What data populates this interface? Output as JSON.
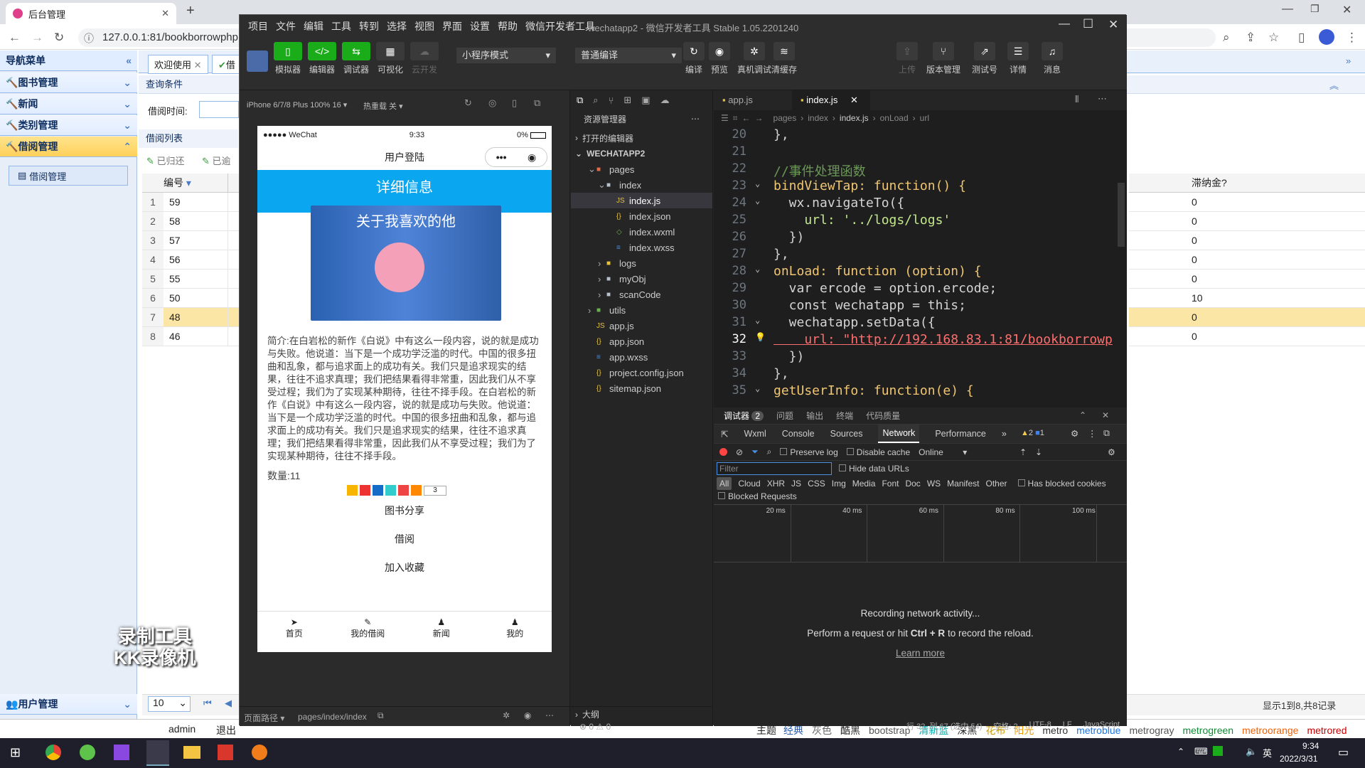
{
  "browser": {
    "tab_title": "后台管理",
    "url": "127.0.0.1:81/bookborrowphp"
  },
  "admin": {
    "nav_title": "导航菜单",
    "nav_sections": [
      {
        "label": "图书管理"
      },
      {
        "label": "新闻"
      },
      {
        "label": "类别管理"
      },
      {
        "label": "借阅管理"
      }
    ],
    "nav_sub_item": "借阅管理",
    "user_section": "用户管理",
    "tabs": [
      "欢迎使用",
      "借"
    ],
    "query_title": "查询条件",
    "borrow_time_label": "借阅时间:",
    "list_title": "借阅列表",
    "btn_returned": "已归还",
    "btn_overdue": "已逾",
    "col_id": "编号",
    "col_fine": "滞纳金?",
    "rows": [
      {
        "n": "1",
        "id": "59",
        "fine": "0"
      },
      {
        "n": "2",
        "id": "58",
        "fine": "0"
      },
      {
        "n": "3",
        "id": "57",
        "fine": "0"
      },
      {
        "n": "4",
        "id": "56",
        "fine": "0"
      },
      {
        "n": "5",
        "id": "55",
        "fine": "0"
      },
      {
        "n": "6",
        "id": "50",
        "fine": "10"
      },
      {
        "n": "7",
        "id": "48",
        "fine": "0"
      },
      {
        "n": "8",
        "id": "46",
        "fine": "0"
      }
    ],
    "page_size": "10",
    "page_info": "显示1到8,共8记录",
    "footer_user": "admin",
    "footer_logout": "退出",
    "theme_label": "主题",
    "themes": [
      "经典",
      "灰色",
      "酷黑",
      "bootstrap",
      "清新蓝",
      "深黑",
      "花布",
      "阳光",
      "metro",
      "metroblue",
      "metrogray",
      "metrogreen",
      "metroorange",
      "metrored"
    ],
    "watermark_line1": "录制工具",
    "watermark_line2": "KK录像机"
  },
  "devtool": {
    "menu": [
      "项目",
      "文件",
      "编辑",
      "工具",
      "转到",
      "选择",
      "视图",
      "界面",
      "设置",
      "帮助",
      "微信开发者工具"
    ],
    "title": "wechatapp2 - 微信开发者工具 Stable 1.05.2201240",
    "toolbar": {
      "simulator": "模拟器",
      "editor": "编辑器",
      "debugger": "调试器",
      "visual": "可视化",
      "cloud": "云开发",
      "mode": "小程序模式",
      "compile_mode": "普通编译",
      "compile": "编译",
      "preview": "预览",
      "real_debug": "真机调试",
      "clear_cache": "清缓存",
      "upload": "上传",
      "version": "版本管理",
      "test": "测试号",
      "details": "详情",
      "message": "消息"
    },
    "sim_device": "iPhone 6/7/8 Plus 100% 16 ▾",
    "sim_hot": "热重载 关 ▾",
    "phone": {
      "carrier": "●●●●● WeChat",
      "time": "9:33",
      "battery": "0%",
      "nav_title": "用户登陆",
      "header": "详细信息",
      "cover_text": "关于我喜欢的他",
      "intro": "简介:在白岩松的新作《白说》中有这么一段内容，说的就是成功与失败。他说道：当下是一个成功学泛滥的时代。中国的很多扭曲和乱象，都与追求面上的成功有关。我们只是追求现实的结果，往往不追求真理；我们把结果看得非常重，因此我们从不享受过程；我们为了实现某种期待，往往不择手段。在白岩松的新作《白说》中有这么一段内容，说的就是成功与失败。他说道：当下是一个成功学泛滥的时代。中国的很多扭曲和乱象，都与追求面上的成功有关。我们只是追求现实的结果，往往不追求真理；我们把结果看得非常重，因此我们从不享受过程；我们为了实现某种期待，往往不择手段。",
      "count": "数量:11",
      "share_count": "3",
      "share": "图书分享",
      "borrow": "借阅",
      "favorite": "加入收藏",
      "tabbar": [
        "首页",
        "我的借阅",
        "新闻",
        "我的"
      ]
    },
    "page_path_label": "页面路径 ▾",
    "page_path": "pages/index/index",
    "explorer": {
      "title": "资源管理器",
      "open_editors": "打开的编辑器",
      "project": "WECHATAPP2",
      "items": [
        {
          "name": "pages",
          "indent": 1,
          "kind": "folder-red"
        },
        {
          "name": "index",
          "indent": 2,
          "kind": "folder"
        },
        {
          "name": "index.js",
          "indent": 3,
          "kind": "js"
        },
        {
          "name": "index.json",
          "indent": 3,
          "kind": "json"
        },
        {
          "name": "index.wxml",
          "indent": 3,
          "kind": "wxml"
        },
        {
          "name": "index.wxss",
          "indent": 3,
          "kind": "wxss"
        },
        {
          "name": "logs",
          "indent": 2,
          "kind": "folder-yellow"
        },
        {
          "name": "myObj",
          "indent": 2,
          "kind": "folder"
        },
        {
          "name": "scanCode",
          "indent": 2,
          "kind": "folder"
        },
        {
          "name": "utils",
          "indent": 1,
          "kind": "folder-green"
        },
        {
          "name": "app.js",
          "indent": 1,
          "kind": "js"
        },
        {
          "name": "app.json",
          "indent": 1,
          "kind": "json"
        },
        {
          "name": "app.wxss",
          "indent": 1,
          "kind": "wxss"
        },
        {
          "name": "project.config.json",
          "indent": 1,
          "kind": "json"
        },
        {
          "name": "sitemap.json",
          "indent": 1,
          "kind": "json"
        }
      ],
      "outline": "大纲",
      "problems": "⊗ 0 ⚠ 0"
    },
    "editor": {
      "tab1": "app.js",
      "tab2": "index.js",
      "breadcrumb": [
        "pages",
        "index",
        "index.js",
        "onLoad",
        "url"
      ],
      "lines": [
        {
          "n": "20",
          "code": "},"
        },
        {
          "n": "21",
          "code": ""
        },
        {
          "n": "22",
          "code": "//事件处理函数"
        },
        {
          "n": "23",
          "code": "bindViewTap: function() {"
        },
        {
          "n": "24",
          "code": "  wx.navigateTo({"
        },
        {
          "n": "25",
          "code": "    url: '../logs/logs'"
        },
        {
          "n": "26",
          "code": "  })"
        },
        {
          "n": "27",
          "code": "},"
        },
        {
          "n": "28",
          "code": "onLoad: function (option) {"
        },
        {
          "n": "29",
          "code": "  var ercode = option.ercode;"
        },
        {
          "n": "30",
          "code": "  const wechatapp = this;"
        },
        {
          "n": "31",
          "code": "  wechatapp.setData({"
        },
        {
          "n": "32",
          "code": "    url: \"http://192.168.83.1:81/bookborrowp"
        },
        {
          "n": "33",
          "code": "  })"
        },
        {
          "n": "34",
          "code": "},"
        },
        {
          "n": "35",
          "code": "getUserInfo: function(e) {"
        }
      ],
      "status": [
        "行 32, 列 67 (选中 54)",
        "空格: 2",
        "UTF-8",
        "LF",
        "JavaScript"
      ]
    },
    "devtools": {
      "tabs": [
        "调试器",
        "问题",
        "输出",
        "终端",
        "代码质量"
      ],
      "debug_count": "2",
      "panel_tabs": [
        "Wxml",
        "Console",
        "Sources",
        "Network",
        "Performance"
      ],
      "warn": "2",
      "info": "1",
      "preserve_log": "Preserve log",
      "disable_cache": "Disable cache",
      "online": "Online",
      "filter_placeholder": "Filter",
      "hide_data_urls": "Hide data URLs",
      "types": [
        "All",
        "Cloud",
        "XHR",
        "JS",
        "CSS",
        "Img",
        "Media",
        "Font",
        "Doc",
        "WS",
        "Manifest",
        "Other"
      ],
      "blocked_cookies": "Has blocked cookies",
      "blocked_requests": "Blocked Requests",
      "timeline": [
        "20 ms",
        "40 ms",
        "60 ms",
        "80 ms",
        "100 ms"
      ],
      "recording": "Recording network activity...",
      "hint_pre": "Perform a request or hit ",
      "hint_key": "Ctrl + R",
      "hint_post": " to record the reload.",
      "learn_more": "Learn more"
    }
  },
  "taskbar": {
    "time": "9:34",
    "date": "2022/3/31",
    "ime": "英"
  }
}
